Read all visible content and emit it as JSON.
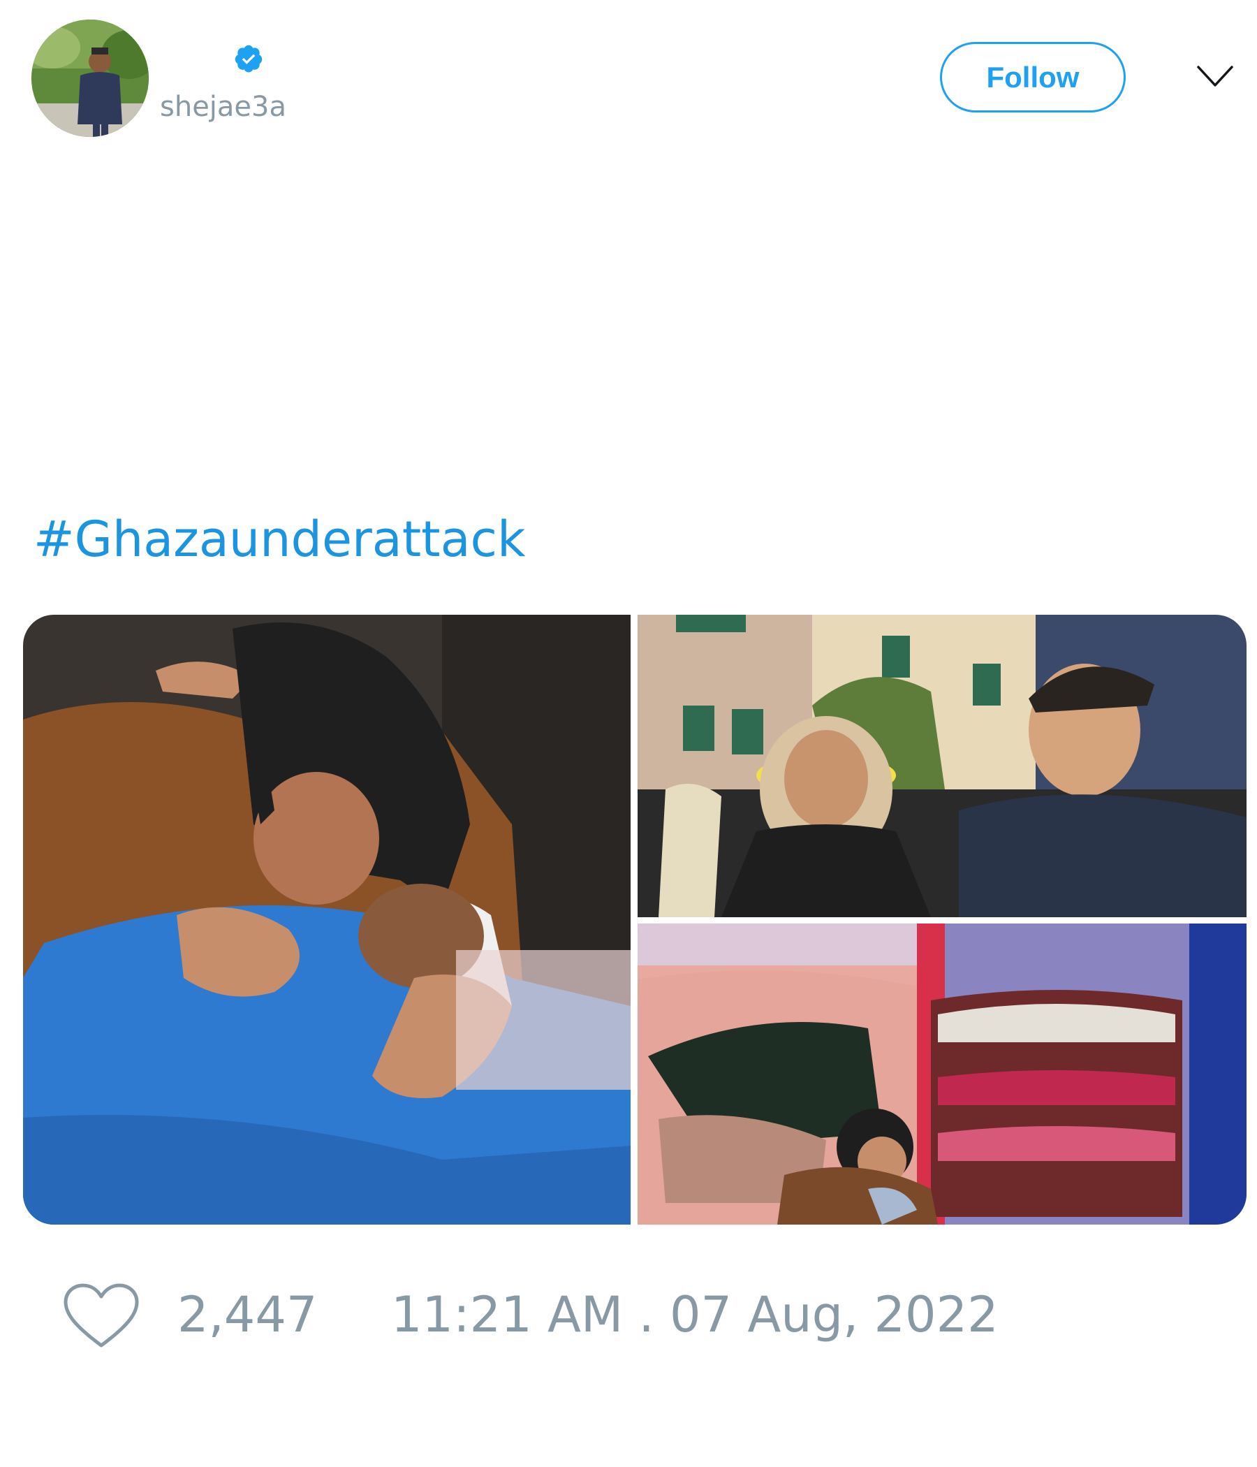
{
  "author": {
    "handle": "shejae3a",
    "verified": true
  },
  "header": {
    "follow_label": "Follow"
  },
  "tweet": {
    "hashtag": "#Ghazaunderattack"
  },
  "media": {
    "count": 3
  },
  "footer": {
    "likes": "2,447",
    "timestamp": "11:21 AM . 07 Aug, 2022"
  },
  "colors": {
    "accent": "#1da1f2",
    "hashtag": "#1b95e0",
    "muted": "#8899a6"
  },
  "icons": {
    "verified": "verified-badge-icon",
    "caret": "chevron-down-icon",
    "like": "heart-icon"
  }
}
